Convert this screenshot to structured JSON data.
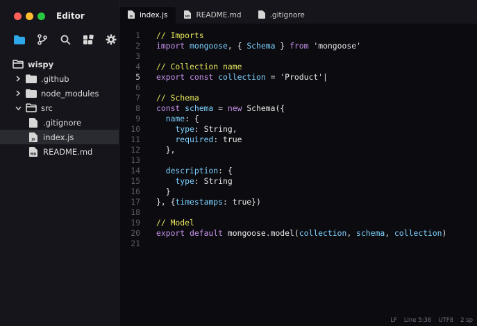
{
  "app": {
    "title": "Editor"
  },
  "sidebar": {
    "root": "wispy",
    "items": [
      {
        "label": ".github",
        "type": "folder",
        "indent": 1,
        "expanded": false
      },
      {
        "label": "node_modules",
        "type": "folder",
        "indent": 1,
        "expanded": false
      },
      {
        "label": "src",
        "type": "folder",
        "indent": 1,
        "expanded": true
      },
      {
        "label": ".gitignore",
        "type": "file",
        "indent": 2,
        "badge": ""
      },
      {
        "label": "index.js",
        "type": "file",
        "indent": 2,
        "badge": "JS",
        "selected": true
      },
      {
        "label": "README.md",
        "type": "file",
        "indent": 2,
        "badge": "MD"
      }
    ]
  },
  "tabs": [
    {
      "label": "index.js",
      "active": true,
      "badge": "JS"
    },
    {
      "label": "README.md",
      "active": false,
      "badge": "MD"
    },
    {
      "label": ".gitignore",
      "active": false,
      "badge": ""
    }
  ],
  "editor": {
    "current_line": 5,
    "lines": [
      [
        [
          "cm",
          "// Imports"
        ]
      ],
      [
        [
          "kw",
          "import "
        ],
        [
          "id",
          "mongoose"
        ],
        [
          "txt",
          ", { "
        ],
        [
          "id",
          "Schema"
        ],
        [
          "txt",
          " } "
        ],
        [
          "kw",
          "from "
        ],
        [
          "st",
          "'mongoose'"
        ]
      ],
      [],
      [
        [
          "cm",
          "// Collection name"
        ]
      ],
      [
        [
          "kw",
          "export const "
        ],
        [
          "id",
          "collection"
        ],
        [
          "txt",
          " = "
        ],
        [
          "st",
          "'Product'|"
        ]
      ],
      [],
      [
        [
          "cm",
          "// Schema"
        ]
      ],
      [
        [
          "kw",
          "const "
        ],
        [
          "id",
          "schema"
        ],
        [
          "txt",
          " = "
        ],
        [
          "kw",
          "new "
        ],
        [
          "txt",
          "Schema({"
        ]
      ],
      [
        [
          "txt",
          "  "
        ],
        [
          "pr",
          "name"
        ],
        [
          "txt",
          ": {"
        ]
      ],
      [
        [
          "txt",
          "    "
        ],
        [
          "pr",
          "type"
        ],
        [
          "txt",
          ": String,"
        ]
      ],
      [
        [
          "txt",
          "    "
        ],
        [
          "pr",
          "required"
        ],
        [
          "txt",
          ": true"
        ]
      ],
      [
        [
          "txt",
          "  },"
        ]
      ],
      [],
      [
        [
          "txt",
          "  "
        ],
        [
          "pr",
          "description"
        ],
        [
          "txt",
          ": {"
        ]
      ],
      [
        [
          "txt",
          "    "
        ],
        [
          "pr",
          "type"
        ],
        [
          "txt",
          ": String"
        ]
      ],
      [
        [
          "txt",
          "  }"
        ]
      ],
      [
        [
          "txt",
          "}, {"
        ],
        [
          "pr",
          "timestamps"
        ],
        [
          "txt",
          ": true})"
        ]
      ],
      [],
      [
        [
          "cm",
          "// Model"
        ]
      ],
      [
        [
          "kw",
          "export default "
        ],
        [
          "txt",
          "mongoose.model("
        ],
        [
          "id",
          "collection"
        ],
        [
          "txt",
          ", "
        ],
        [
          "id",
          "schema"
        ],
        [
          "txt",
          ", "
        ],
        [
          "id",
          "collection"
        ],
        [
          "txt",
          ")"
        ]
      ],
      []
    ]
  },
  "status": {
    "eol": "LF",
    "position": "Line 5:36",
    "encoding": "UTF8",
    "indent": "2 sp"
  },
  "colors": {
    "accent": "#2ea8e8",
    "keyword": "#c792ea",
    "comment": "#e9e85a",
    "identifier": "#7fd1ff"
  }
}
